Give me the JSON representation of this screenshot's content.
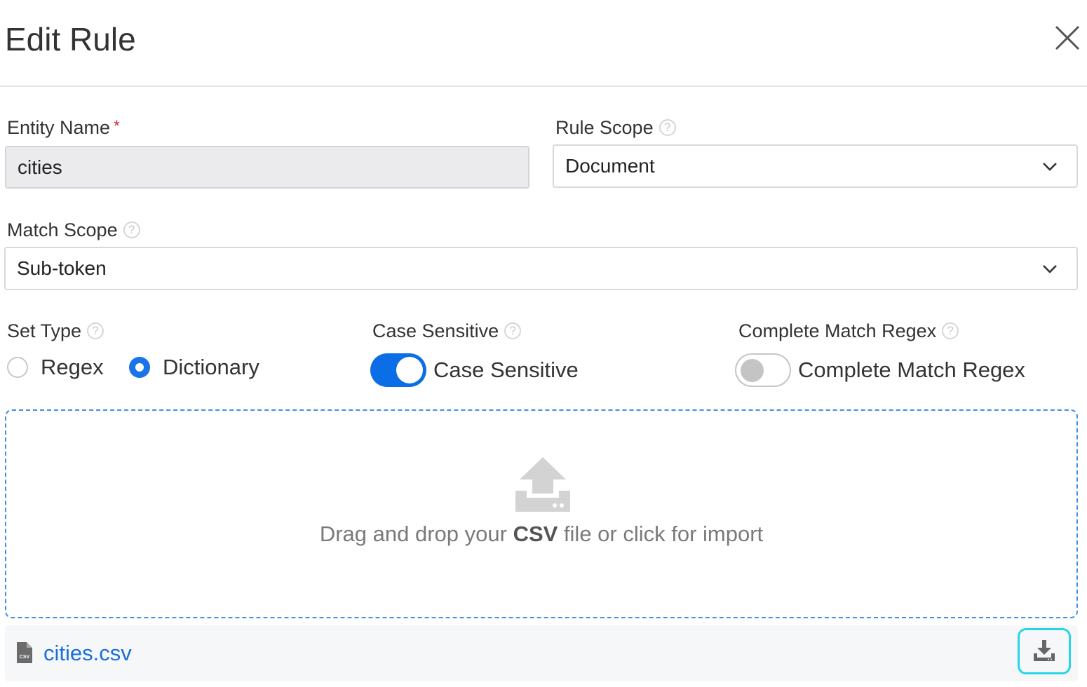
{
  "dialog": {
    "title": "Edit Rule",
    "close_icon": "close-icon"
  },
  "form": {
    "entity_name": {
      "label": "Entity Name",
      "required_mark": "*",
      "value": "cities"
    },
    "rule_scope": {
      "label": "Rule Scope",
      "help_mark": "?",
      "value": "Document"
    },
    "match_scope": {
      "label": "Match Scope",
      "help_mark": "?",
      "value": "Sub-token"
    },
    "set_type": {
      "label": "Set Type",
      "help_mark": "?",
      "options": [
        {
          "label": "Regex",
          "selected": false
        },
        {
          "label": "Dictionary",
          "selected": true
        }
      ]
    },
    "case_sensitive": {
      "label": "Case Sensitive",
      "help_mark": "?",
      "toggle_label": "Case Sensitive",
      "on": true
    },
    "complete_match_regex": {
      "label": "Complete Match Regex",
      "help_mark": "?",
      "toggle_label": "Complete Match Regex",
      "on": false
    }
  },
  "upload": {
    "text_before": "Drag and drop your ",
    "text_bold": "CSV",
    "text_after": " file or click for import",
    "icon": "upload-icon"
  },
  "file": {
    "name": "cities.csv",
    "icon": "csv-file-icon",
    "download_icon": "download-icon"
  },
  "colors": {
    "accent": "#1a73e8",
    "link": "#1a6fdc",
    "required": "#e02020",
    "dropzone_border": "#3d8ef0",
    "focus_ring": "#27d6e6"
  }
}
